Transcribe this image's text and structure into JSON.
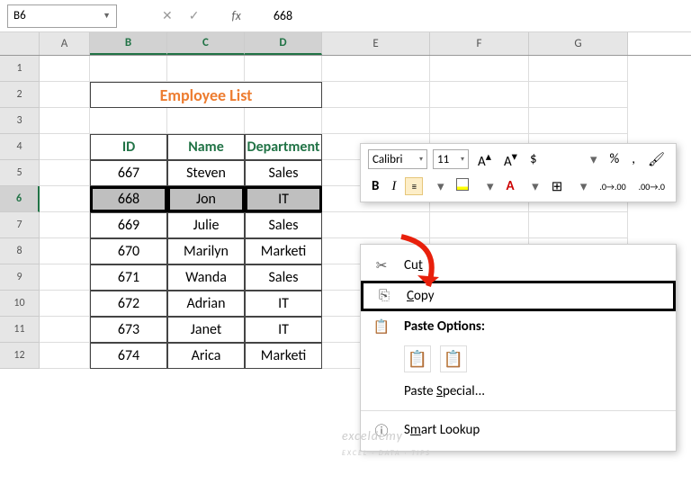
{
  "namebox": {
    "ref": "B6"
  },
  "formula_bar": {
    "fx": "fx",
    "value": "668"
  },
  "columns": [
    "A",
    "B",
    "C",
    "D",
    "E",
    "F",
    "G"
  ],
  "selected_cols": [
    "B",
    "C",
    "D"
  ],
  "rows": [
    "1",
    "2",
    "3",
    "4",
    "5",
    "6",
    "7",
    "8",
    "9",
    "10",
    "11",
    "12"
  ],
  "selected_row": "6",
  "title_cell": "Employee List",
  "table_headers": [
    "ID",
    "Name",
    "Department"
  ],
  "chart_data": {
    "type": "table",
    "columns": [
      "ID",
      "Name",
      "Department"
    ],
    "rows": [
      [
        667,
        "Steven",
        "Sales"
      ],
      [
        668,
        "Jon",
        "IT"
      ],
      [
        669,
        "Julie",
        "Sales"
      ],
      [
        670,
        "Marilyn",
        "Marketing"
      ],
      [
        671,
        "Wanda",
        "Sales"
      ],
      [
        672,
        "Adrian",
        "IT"
      ],
      [
        673,
        "Janet",
        "IT"
      ],
      [
        674,
        "Arica",
        "Marketing"
      ]
    ],
    "visible_department_text": [
      "Sales",
      "IT",
      "Sales",
      "Marketi",
      "Sales",
      "IT",
      "IT",
      "Marketi"
    ]
  },
  "mini_toolbar": {
    "font_name": "Calibri",
    "font_size": "11",
    "buttons": {
      "bold": "B",
      "italic": "I",
      "align": "≡",
      "fill": "fill",
      "font_color": "A",
      "border": "⊞",
      "decimals_inc": ".00",
      "decimals_dec": ".00",
      "increase_font": "A",
      "decrease_font": "A",
      "currency": "$",
      "percent": "%",
      "format_painter": "✎"
    }
  },
  "context_menu": {
    "cut": "Cut",
    "copy": "Copy",
    "paste_options": "Paste Options:",
    "paste_special": "Paste Special...",
    "smart_lookup": "Smart Lookup"
  },
  "watermark": {
    "main": "exceldemy",
    "sub": "EXCEL · DATA · TIPS"
  }
}
